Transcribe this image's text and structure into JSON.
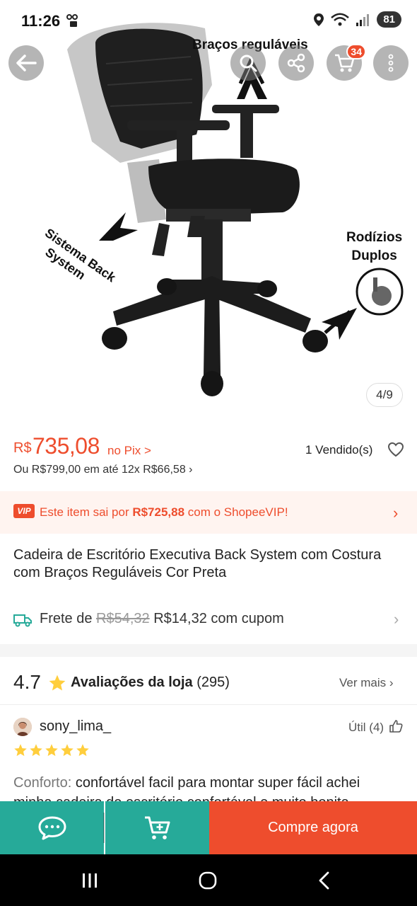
{
  "status": {
    "time": "11:26",
    "battery": "81"
  },
  "header": {
    "cart_count": "34",
    "image_counter": "4/9"
  },
  "image_annotations": {
    "arms": "Braços reguláveis",
    "back_line1": "Sistema Back",
    "back_line2": "System",
    "wheels_line1": "Rodízios",
    "wheels_line2": "Duplos"
  },
  "price": {
    "currency": "R$",
    "value": "735,08",
    "pix_label": "no Pix >",
    "sold": "1 Vendido(s)",
    "installments": "Ou R$799,00 em até 12x R$66,58 ›"
  },
  "vip": {
    "badge": "VIP",
    "text_before": "Este item sai por ",
    "price": "R$725,88",
    "text_after": " com o ShopeeVIP!",
    "chevron": "›"
  },
  "product": {
    "title": "Cadeira de Escritório Executiva Back System com Costura com Braços Reguláveis Cor Preta"
  },
  "shipping": {
    "prefix": "Frete de ",
    "old_price": "R$54,32",
    "new_price": " R$14,32 com cupom",
    "chevron": "›"
  },
  "reviews": {
    "rating": "4.7",
    "label": "Avaliações da loja",
    "count": " (295)",
    "see_more": "Ver mais ›",
    "item": {
      "user": "sony_lima_",
      "useful": "Útil (4)",
      "stars": 5,
      "key": "Conforto:",
      "text": " confortável facil para montar super fácil achei",
      "next_line": "minha cadeira de escritório confortável e muito bonita"
    }
  },
  "actions": {
    "buy_label": "Compre agora"
  },
  "colors": {
    "brand": "#ee4d2d",
    "teal": "#26aa99",
    "star": "#ffce3d"
  },
  "icons": [
    "back-arrow-icon",
    "search-icon",
    "share-icon",
    "cart-icon",
    "more-icon",
    "heart-icon",
    "truck-icon",
    "star-icon",
    "thumbs-up-icon",
    "chat-icon",
    "add-to-cart-icon",
    "recent-apps-icon",
    "home-icon",
    "nav-back-icon"
  ]
}
